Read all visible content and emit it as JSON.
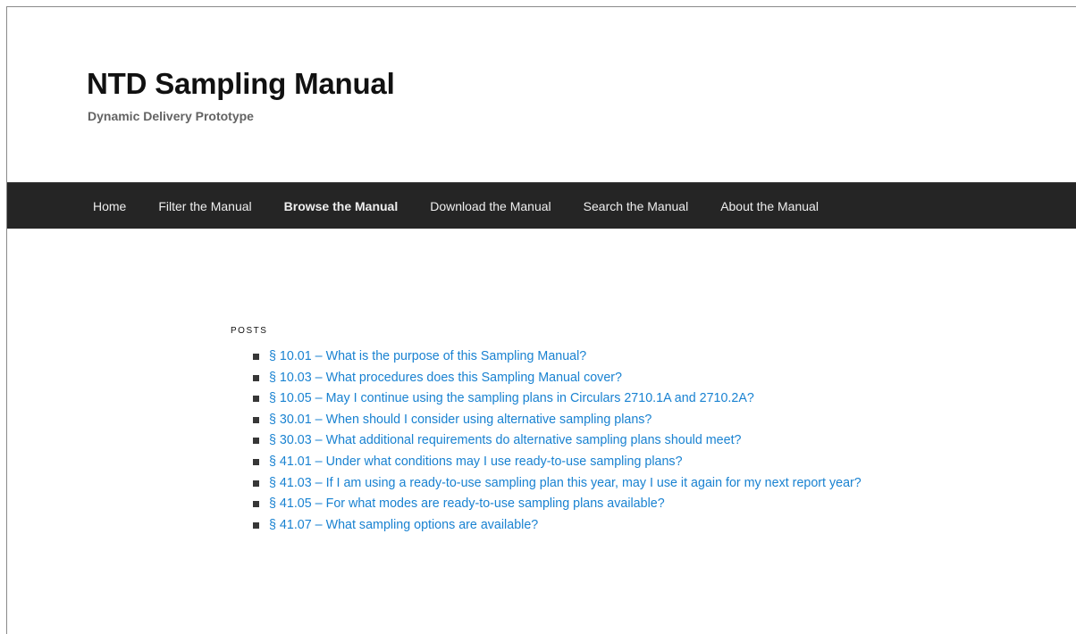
{
  "site": {
    "title": "NTD Sampling Manual",
    "description": "Dynamic Delivery Prototype"
  },
  "nav": {
    "items": [
      {
        "label": "Home",
        "current": false
      },
      {
        "label": "Filter the Manual",
        "current": false
      },
      {
        "label": "Browse the Manual",
        "current": true
      },
      {
        "label": "Download the Manual",
        "current": false
      },
      {
        "label": "Search the Manual",
        "current": false
      },
      {
        "label": "About the Manual",
        "current": false
      }
    ]
  },
  "posts_widget": {
    "title": "POSTS",
    "items": [
      {
        "text": "§ 10.01 – What is the purpose of this Sampling Manual?"
      },
      {
        "text": "§ 10.03 – What procedures does this Sampling Manual cover?"
      },
      {
        "text": "§ 10.05 – May I continue using the sampling plans in Circulars 2710.1A and 2710.2A?"
      },
      {
        "text": "§ 30.01 – When should I consider using alternative sampling plans?"
      },
      {
        "text": "§ 30.03 – What additional requirements do alternative sampling plans should meet?"
      },
      {
        "text": "§ 41.01 – Under what conditions may I use ready-to-use sampling plans?"
      },
      {
        "text": "§ 41.03 – If I am using a ready-to-use sampling plan this year, may I use it again for my next report year?"
      },
      {
        "text": "§ 41.05 – For what modes are ready-to-use sampling plans available?"
      },
      {
        "text": "§ 41.07 – What sampling options are available?"
      }
    ]
  },
  "colors": {
    "nav_background": "#252525",
    "link": "#1982d1",
    "title": "#111111"
  }
}
